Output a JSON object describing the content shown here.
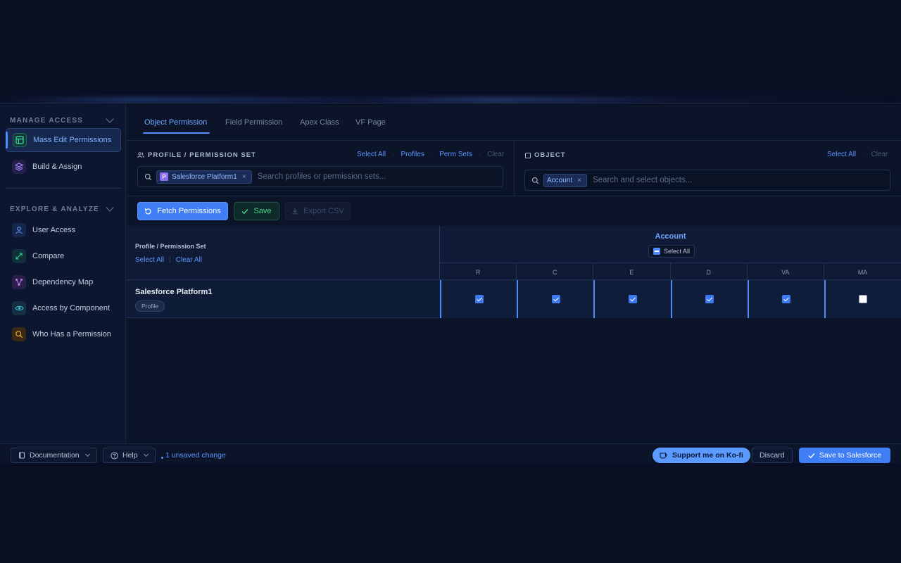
{
  "sidebar": {
    "manage_access_title": "MANAGE ACCESS",
    "explore_title": "EXPLORE & ANALYZE",
    "items": [
      {
        "label": "Mass Edit Permissions",
        "icon": "table-icon",
        "color": "#2fb98a"
      },
      {
        "label": "Build & Assign",
        "icon": "layers-icon",
        "color": "#9b7cf5"
      },
      {
        "label": "User Access",
        "icon": "user-icon",
        "color": "#5d97ff"
      },
      {
        "label": "Compare",
        "icon": "expand-arrows-icon",
        "color": "#2fb98a"
      },
      {
        "label": "Dependency Map",
        "icon": "network-icon",
        "color": "#b86cf0"
      },
      {
        "label": "Access by Component",
        "icon": "eye-icon",
        "color": "#3ab6c9"
      },
      {
        "label": "Who Has a Permission",
        "icon": "search-icon",
        "color": "#e3a13c"
      }
    ]
  },
  "tabs": [
    "Object Permission",
    "Field Permission",
    "Apex Class",
    "VF Page"
  ],
  "profile_filter": {
    "label": "PROFILE / PERMISSION SET",
    "links": [
      "Select All",
      "Profiles",
      "Perm Sets",
      "Clear"
    ],
    "chip_badge": "P",
    "chip": "Salesforce Platform1",
    "placeholder": "Search profiles or permission sets..."
  },
  "object_filter": {
    "label": "OBJECT",
    "links": [
      "Select All",
      "Clear"
    ],
    "chip": "Account",
    "placeholder": "Search and select objects..."
  },
  "actions": {
    "fetch": "Fetch Permissions",
    "save": "Save",
    "export": "Export CSV"
  },
  "matrix": {
    "left_header": "Profile / Permission Set",
    "select_all": "Select All",
    "divider": "|",
    "clear_all": "Clear All",
    "object": "Account",
    "object_select_all": "Select All",
    "columns": [
      "R",
      "C",
      "E",
      "D",
      "VA",
      "MA"
    ],
    "rows": [
      {
        "name": "Salesforce Platform1",
        "type": "Profile",
        "values": [
          true,
          true,
          true,
          true,
          true,
          false
        ]
      }
    ]
  },
  "footer": {
    "documentation": "Documentation",
    "help": "Help",
    "unsaved": "1 unsaved change",
    "kofi": "Support me on Ko-fi",
    "discard": "Discard",
    "save_sf": "Save to Salesforce"
  }
}
